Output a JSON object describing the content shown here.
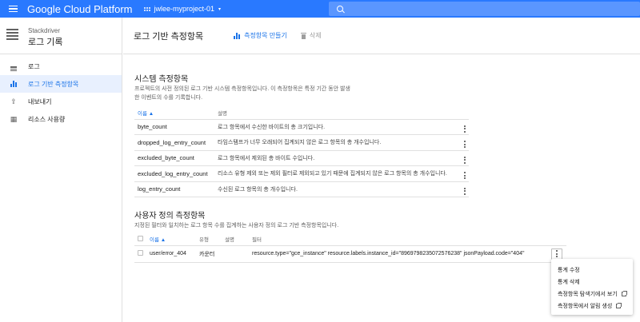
{
  "topbar": {
    "brand": "Google Cloud Platform",
    "project": "jwlee-myproject-01",
    "caret": "▾"
  },
  "sidebar": {
    "service": "Stackdriver",
    "product": "로그 기록",
    "items": [
      {
        "label": "로그",
        "icon": "list-icon"
      },
      {
        "label": "로그 기반 측정항목",
        "icon": "bar-chart-icon"
      },
      {
        "label": "내보내기",
        "icon": "upload-icon"
      },
      {
        "label": "리소스 사용량",
        "icon": "storage-icon"
      }
    ]
  },
  "header": {
    "title": "로그 기반 측정항목",
    "create_label": "측정항목 만들기",
    "delete_label": "삭제"
  },
  "system": {
    "title": "시스템 측정항목",
    "desc_line1": "프로젝트의 사전 정의된 로그 기반 시스템 측정항목입니다. 이 측정항목은 특정 기간 동안 발생",
    "desc_line2": "한 이벤트의 수를 기록합니다.",
    "col_name": "이름 ▲",
    "col_desc": "설명",
    "rows": [
      {
        "name": "byte_count",
        "desc": "로그 항목에서 수신한 바이트의 총 크기입니다."
      },
      {
        "name": "dropped_log_entry_count",
        "desc": "타임스탬프가 너무 오래되어 집계되지 않은 로그 항목의 총 개수입니다."
      },
      {
        "name": "excluded_byte_count",
        "desc": "로그 항목에서 제외된 총 바이트 수입니다."
      },
      {
        "name": "excluded_log_entry_count",
        "desc": "리소스 유형 제외 또는 제외 필터로 제외되고 있기 때문에 집계되지 않은 로그 항목의 총 개수입니다."
      },
      {
        "name": "log_entry_count",
        "desc": "수신된 로그 항목의 총 개수입니다."
      }
    ]
  },
  "user": {
    "title": "사용자 정의 측정항목",
    "desc": "지정된 필터와 일치하는 로그 항목 수를 집계하는 사용자 정의 로그 기반 측정항목입니다.",
    "col_name": "이름 ▲",
    "col_type": "유형",
    "col_desc": "설명",
    "col_filter": "필터",
    "rows": [
      {
        "name": "user/error_404",
        "type": "카운터",
        "desc": "",
        "filter": "resource.type=\"gce_instance\" resource.labels.instance_id=\"8969798235072576238\" jsonPayload.code=\"404\""
      }
    ]
  },
  "menu": {
    "items": [
      {
        "label": "통계 수정"
      },
      {
        "label": "통계 삭제"
      },
      {
        "label": "측정항목 탐색기에서 보기"
      },
      {
        "label": "측정항목에서 알림 생성"
      }
    ]
  }
}
